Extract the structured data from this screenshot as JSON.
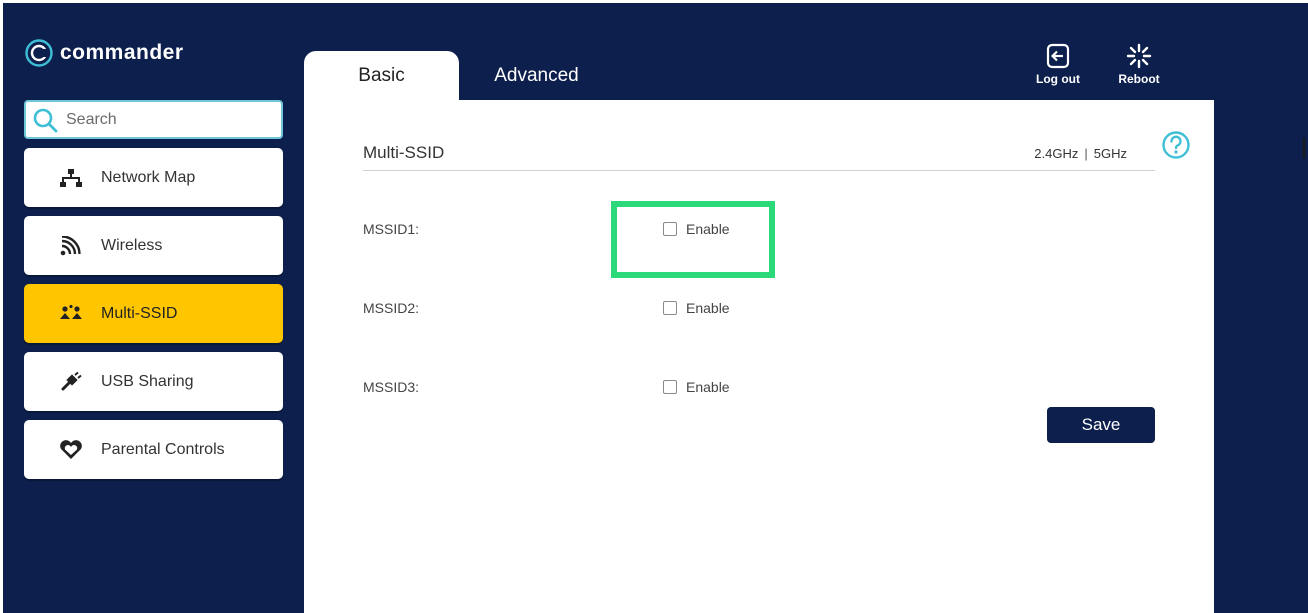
{
  "app": {
    "brand": "commander"
  },
  "search": {
    "placeholder": "Search"
  },
  "sidebar": {
    "items": [
      {
        "label": "Network Map",
        "icon": "network-map-icon"
      },
      {
        "label": "Wireless",
        "icon": "wireless-icon"
      },
      {
        "label": "Multi-SSID",
        "icon": "multi-ssid-icon",
        "active": true
      },
      {
        "label": "USB Sharing",
        "icon": "usb-icon"
      },
      {
        "label": "Parental Controls",
        "icon": "heart-shield-icon"
      }
    ]
  },
  "tabs": {
    "basic": "Basic",
    "advanced": "Advanced"
  },
  "actions": {
    "logout": "Log out",
    "reboot": "Reboot"
  },
  "section": {
    "title": "Multi-SSID",
    "band_24": "2.4GHz",
    "band_sep": "|",
    "band_5": "5GHz"
  },
  "mssid": [
    {
      "label": "MSSID1:",
      "enable_label": "Enable",
      "checked": false
    },
    {
      "label": "MSSID2:",
      "enable_label": "Enable",
      "checked": false
    },
    {
      "label": "MSSID3:",
      "enable_label": "Enable",
      "checked": false
    }
  ],
  "save_label": "Save",
  "colors": {
    "background": "#0c1f4d",
    "accent_active": "#ffc600",
    "highlight": "#2bd87a",
    "help": "#3fbfd6"
  }
}
